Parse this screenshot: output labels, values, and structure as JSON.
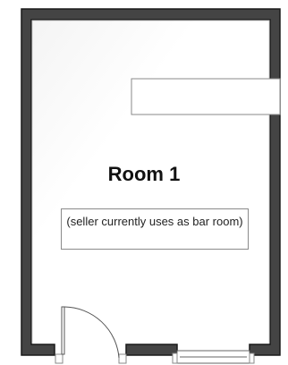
{
  "room": {
    "title": "Room 1",
    "note": "(seller currently uses as bar room)"
  },
  "fixtures": [
    {
      "kind": "counter"
    },
    {
      "kind": "door",
      "swing": "inward"
    },
    {
      "kind": "window"
    }
  ],
  "colors": {
    "wall_dark": "#444444",
    "wall_outline": "#1a1a1a",
    "floor": "#ffffff",
    "fixture_line": "#8a8a8a"
  }
}
